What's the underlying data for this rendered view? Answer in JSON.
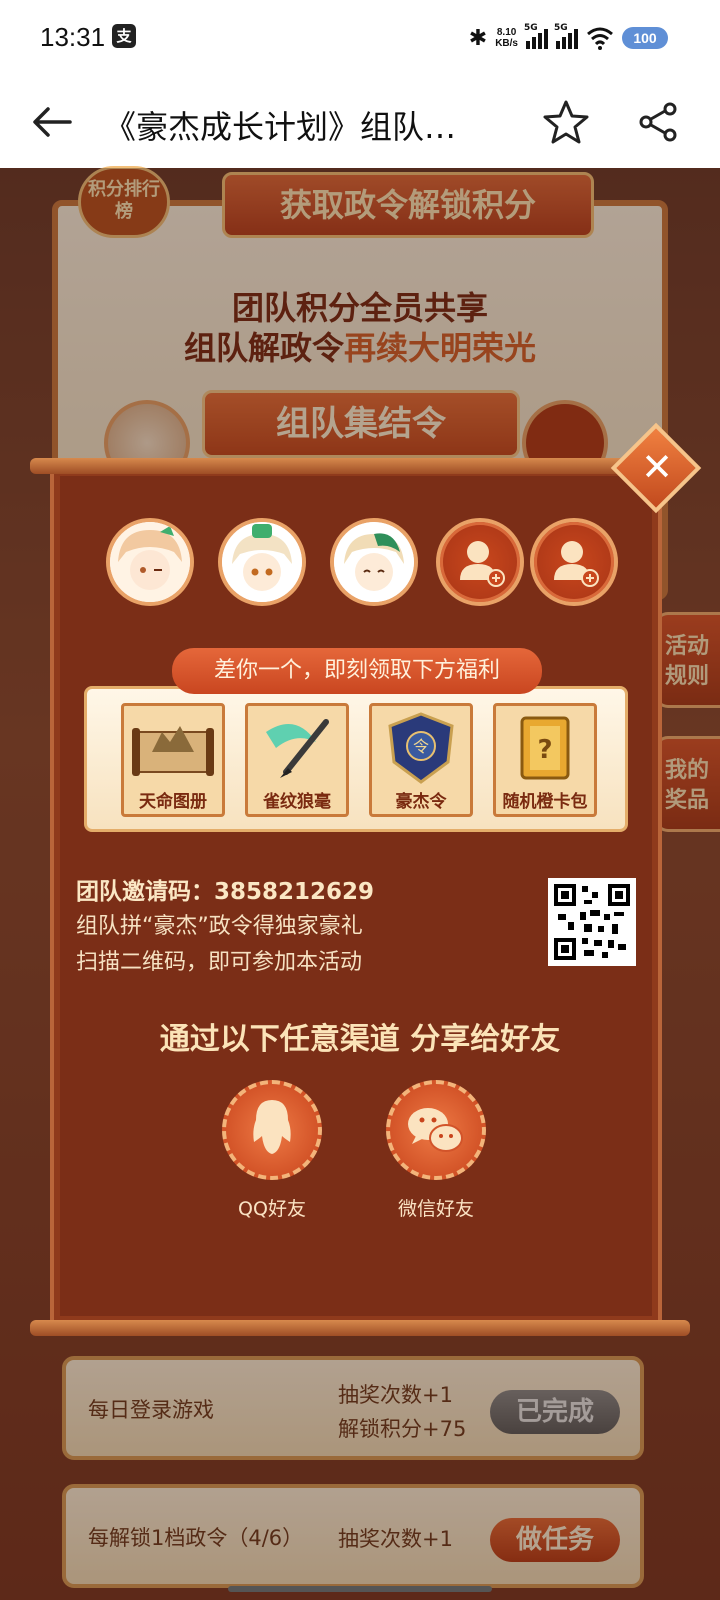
{
  "status_bar": {
    "time": "13:31",
    "app_badge": "支",
    "net_speed_value": "8.10",
    "net_speed_unit": "KB/s",
    "signal1": "5G",
    "signal2": "5G",
    "battery": "100"
  },
  "nav": {
    "title": "《豪杰成长计划》组队…"
  },
  "background": {
    "rank_badge": "积分排行榜",
    "header_banner": "获取政令解锁积分",
    "slogan_line1": "团队积分全员共享",
    "slogan_line2_prefix": "组队解政令",
    "slogan_line2_highlight": "再续大明荣光",
    "team_banner": "组队集结令",
    "side_tab_rules": "活动规则",
    "side_tab_prizes": "我的奖品"
  },
  "modal": {
    "reward_banner": "差你一个，即刻领取下方福利",
    "rewards": [
      {
        "name": "天命图册",
        "icon": "scroll-map-icon"
      },
      {
        "name": "雀纹狼毫",
        "icon": "brush-icon"
      },
      {
        "name": "豪杰令",
        "icon": "token-icon"
      },
      {
        "name": "随机橙卡包",
        "icon": "mystery-card-icon"
      }
    ],
    "invite_label": "团队邀请码：",
    "invite_code": "3858212629",
    "invite_line1": "组队拼“豪杰”政令得独家豪礼",
    "invite_line2": "扫描二维码，即可参加本活动",
    "share_title": "通过以下任意渠道 分享给好友",
    "share_qq": "QQ好友",
    "share_wechat": "微信好友"
  },
  "tasks": [
    {
      "name": "每日登录游戏",
      "reward1": "抽奖次数+1",
      "reward2": "解锁积分+75",
      "button": "已完成",
      "state": "done"
    },
    {
      "name": "每解锁1档政令（4/6）",
      "reward1": "抽奖次数+1",
      "reward2": "",
      "button": "做任务",
      "state": "todo"
    }
  ],
  "colors": {
    "modal_bg": "#7b2e17",
    "accent": "#e0673a",
    "gold": "#f6c278"
  }
}
